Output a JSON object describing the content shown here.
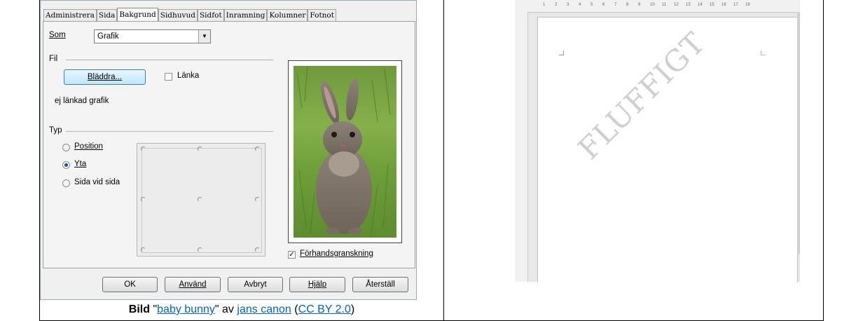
{
  "dialog": {
    "tabs": [
      "Administrera",
      "Sida",
      "Bakgrund",
      "Sidhuvud",
      "Sidfot",
      "Inramning",
      "Kolumner",
      "Fotnot"
    ],
    "active_tab": "Bakgrund",
    "som_label": "Som",
    "som_value": "Grafik",
    "fil_label": "Fil",
    "browse_button": "Bläddra...",
    "link_checkbox": "Länka",
    "link_checked": false,
    "link_status": "ej länkad grafik",
    "typ_label": "Typ",
    "type_options": [
      "Position",
      "Yta",
      "Sida vid sida"
    ],
    "selected_type": "Yta",
    "preview_checkbox": "Förhandsgranskning",
    "preview_checked": true,
    "buttons": [
      "OK",
      "Använd",
      "Avbryt",
      "Hjälp",
      "Återställ"
    ]
  },
  "document_preview": {
    "watermark_text": "FLUFFIGT",
    "ruler_top_numbers": [
      "1",
      "2",
      "3",
      "4",
      "5",
      "6",
      "7",
      "8",
      "9",
      "10",
      "11",
      "12",
      "13",
      "14",
      "15",
      "16",
      "17",
      "18"
    ]
  },
  "caption": {
    "bold_word": "Bild",
    "quote_open": "\"",
    "title_link": "baby bunny",
    "quote_close": "\"",
    "av": "av",
    "author_link": "jans canon",
    "paren_open": "(",
    "license_link": "CC BY 2.0",
    "paren_close": ")"
  },
  "colors": {
    "link": "#0563c1",
    "dialog_bg": "#f0f0f0",
    "focus_button": "#bee6fd",
    "radio_dot": "#1f4f9e"
  }
}
